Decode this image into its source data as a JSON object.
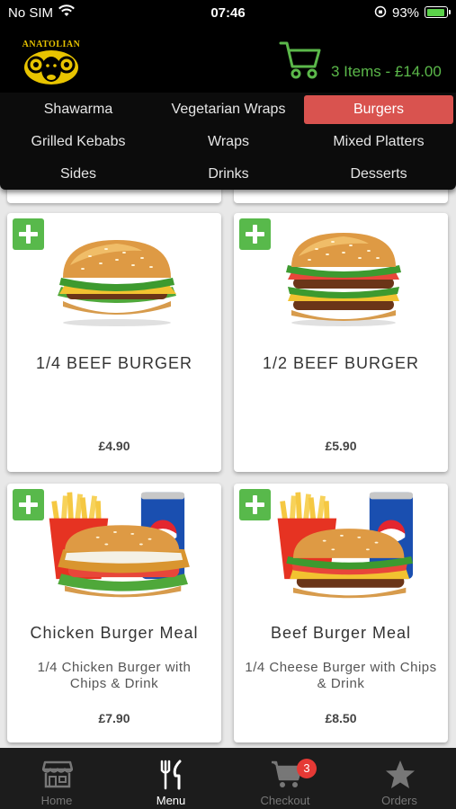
{
  "status": {
    "carrier": "No SIM",
    "time": "07:46",
    "battery": "93%",
    "battery_level": 0.93
  },
  "header": {
    "brand": "ANATOLIAN",
    "cart_summary": "3 Items - £14.00"
  },
  "categories": [
    {
      "label": "Shawarma",
      "active": false
    },
    {
      "label": "Vegetarian Wraps",
      "active": false
    },
    {
      "label": "Burgers",
      "active": true
    },
    {
      "label": "Grilled Kebabs",
      "active": false
    },
    {
      "label": "Wraps",
      "active": false
    },
    {
      "label": "Mixed Platters",
      "active": false
    },
    {
      "label": "Sides",
      "active": false
    },
    {
      "label": "Drinks",
      "active": false
    },
    {
      "label": "Desserts",
      "active": false
    }
  ],
  "products": [
    {
      "name": "1/4 BEEF BURGER",
      "description": "",
      "price": "£4.90",
      "image": "burger-image"
    },
    {
      "name": "1/2 BEEF BURGER",
      "description": "",
      "price": "£5.90",
      "image": "double-burger-image"
    },
    {
      "name": "Chicken Burger Meal",
      "description": "1/4 Chicken Burger with Chips & Drink",
      "price": "£7.90",
      "image": "chicken-burger-meal-image"
    },
    {
      "name": "Beef Burger Meal",
      "description": "1/4 Cheese Burger with Chips & Drink",
      "price": "£8.50",
      "image": "beef-burger-meal-image"
    }
  ],
  "tabs": [
    {
      "label": "Home",
      "icon": "shop-icon",
      "active": false
    },
    {
      "label": "Menu",
      "icon": "cutlery-icon",
      "active": true
    },
    {
      "label": "Checkout",
      "icon": "cart-icon",
      "active": false
    },
    {
      "label": "Orders",
      "icon": "star-icon",
      "active": false
    }
  ],
  "checkout_badge": "3",
  "colors": {
    "accent": "#d9534f",
    "brand_green": "#58b94b",
    "cart_text": "#5bb84a",
    "logo_gold": "#e8c400"
  }
}
